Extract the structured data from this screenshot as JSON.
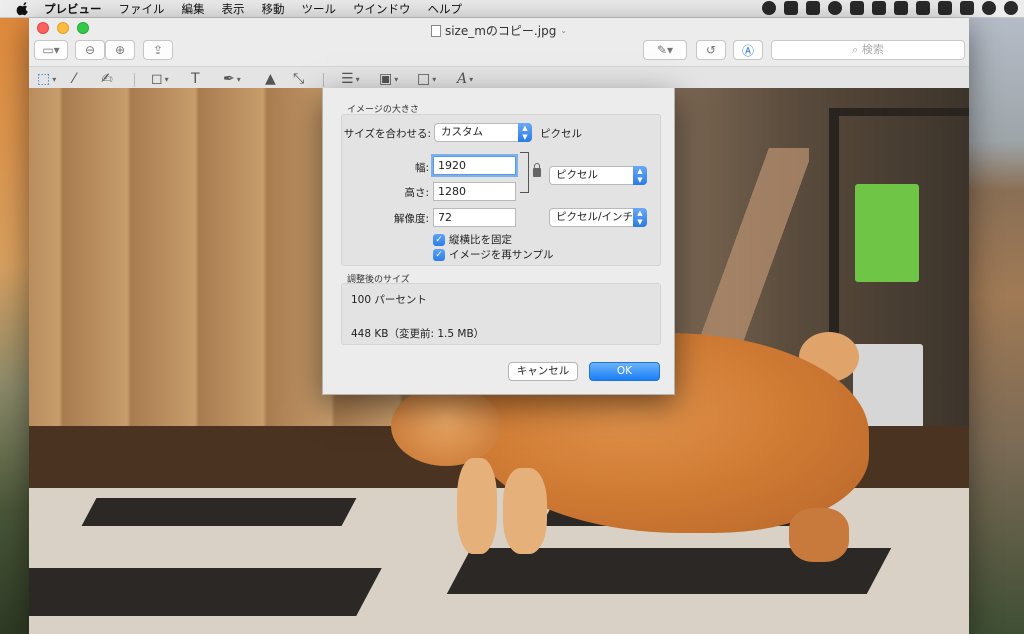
{
  "menubar": {
    "items": [
      "プレビュー",
      "ファイル",
      "編集",
      "表示",
      "移動",
      "ツール",
      "ウインドウ",
      "ヘルプ"
    ]
  },
  "window": {
    "title": "size_mのコピー.jpg",
    "search_placeholder": "検索"
  },
  "dialog": {
    "section_title": "イメージの大きさ",
    "fit_label": "サイズを合わせる:",
    "fit_value": "カスタム",
    "fit_unit": "ピクセル",
    "width_label": "幅:",
    "width_value": "1920",
    "height_label": "高さ:",
    "height_value": "1280",
    "size_unit": "ピクセル",
    "resolution_label": "解像度:",
    "resolution_value": "72",
    "resolution_unit": "ピクセル/インチ",
    "keep_ratio": "縦横比を固定",
    "resample": "イメージを再サンプル",
    "result_title": "調整後のサイズ",
    "result_percent": "100 パーセント",
    "result_size": "448 KB（変更前: 1.5 MB）",
    "cancel_label": "キャンセル",
    "ok_label": "OK"
  }
}
